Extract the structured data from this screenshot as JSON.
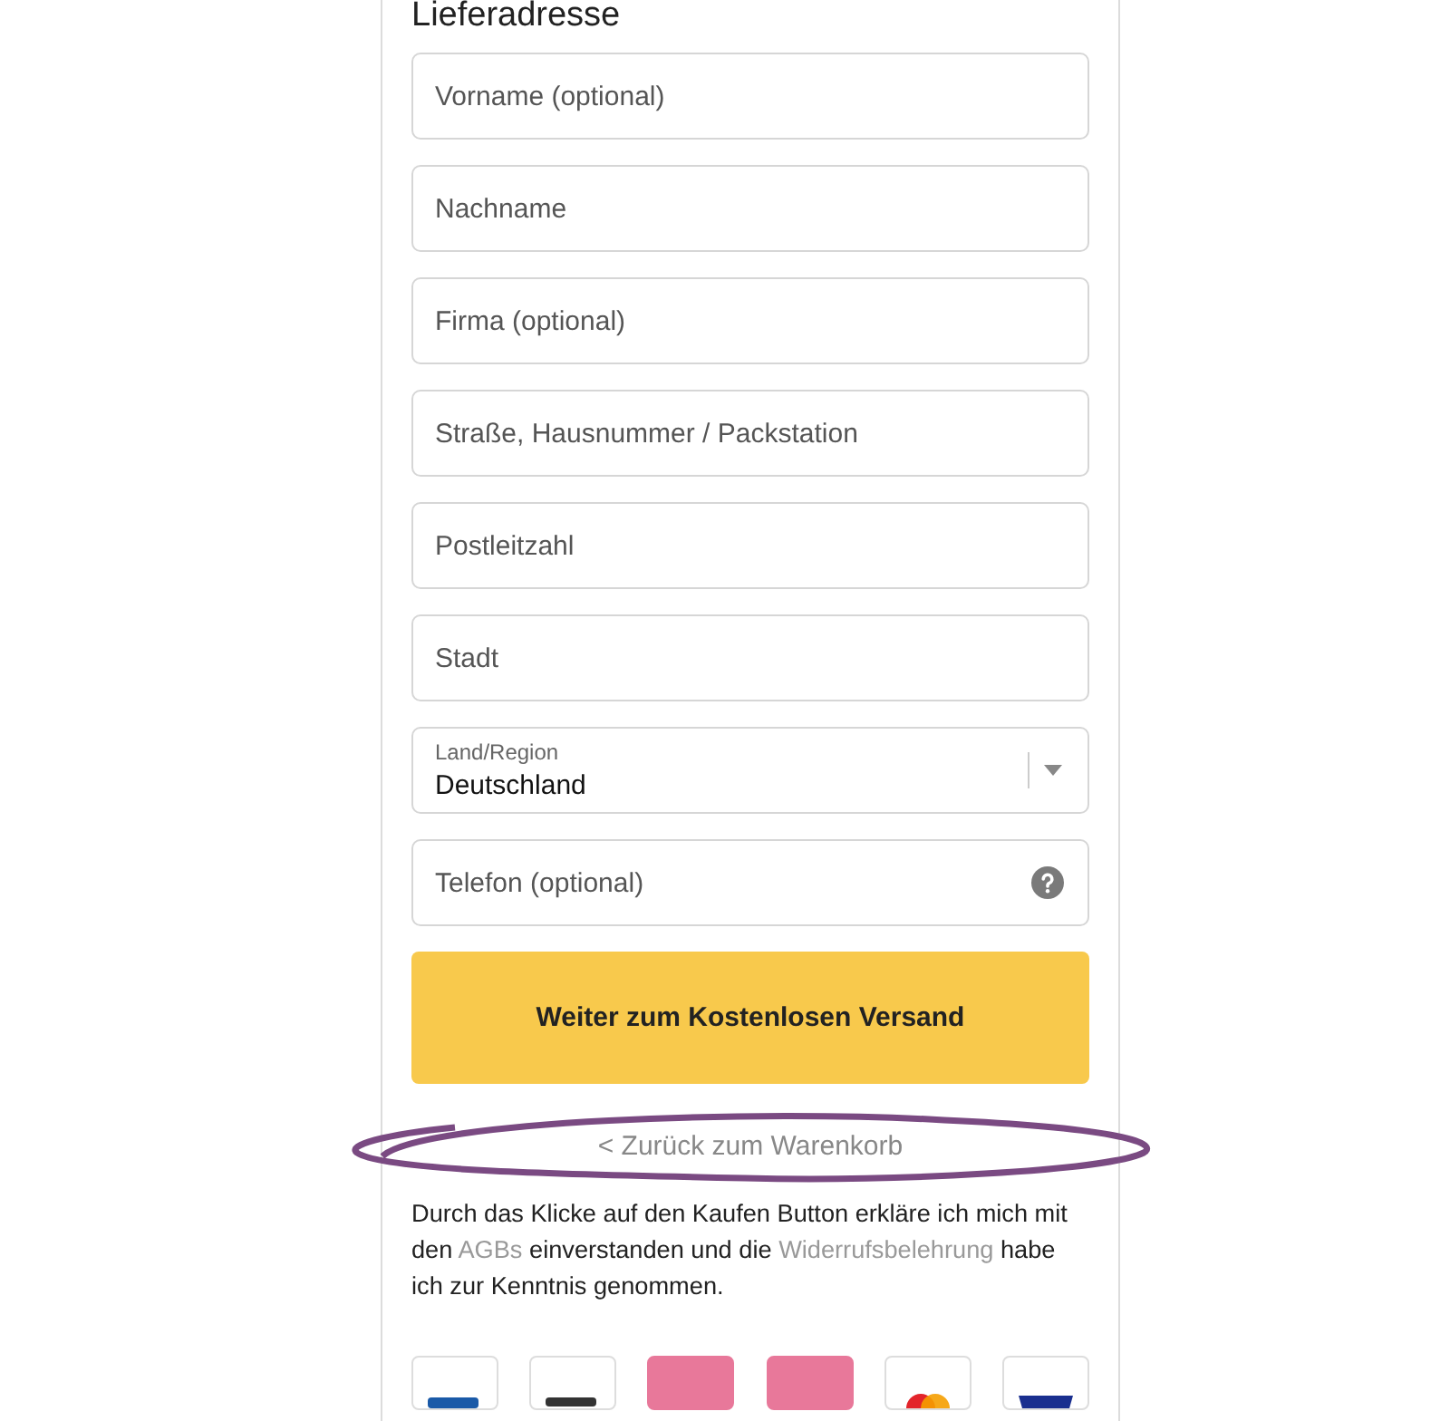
{
  "section_title": "Lieferadresse",
  "fields": [
    {
      "kind": "text",
      "placeholder": "Vorname (optional)",
      "help": false
    },
    {
      "kind": "text",
      "placeholder": "Nachname",
      "help": false
    },
    {
      "kind": "text",
      "placeholder": "Firma (optional)",
      "help": false
    },
    {
      "kind": "text",
      "placeholder": "Straße, Hausnummer / Packstation",
      "help": false
    },
    {
      "kind": "text",
      "placeholder": "Postleitzahl",
      "help": false
    },
    {
      "kind": "text",
      "placeholder": "Stadt",
      "help": false
    },
    {
      "kind": "select",
      "label": "Land/Region",
      "value": "Deutschland"
    },
    {
      "kind": "text",
      "placeholder": "Telefon (optional)",
      "help": true
    }
  ],
  "continue_button": "Weiter zum Kostenlosen Versand",
  "back_link": {
    "icon": "<",
    "label": "Zurück zum Warenkorb",
    "circled": true
  },
  "legal_text": [
    {
      "kind": "text",
      "text": "Durch das Klicke auf den Kaufen Button erkläre ich mich mit den "
    },
    {
      "kind": "link",
      "text": "AGBs"
    },
    {
      "kind": "text",
      "text": " einverstanden und die "
    },
    {
      "kind": "link",
      "text": "Widerrufsbelehrung"
    },
    {
      "kind": "text",
      "text": " habe ich zur Kenntnis genommen."
    }
  ]
}
